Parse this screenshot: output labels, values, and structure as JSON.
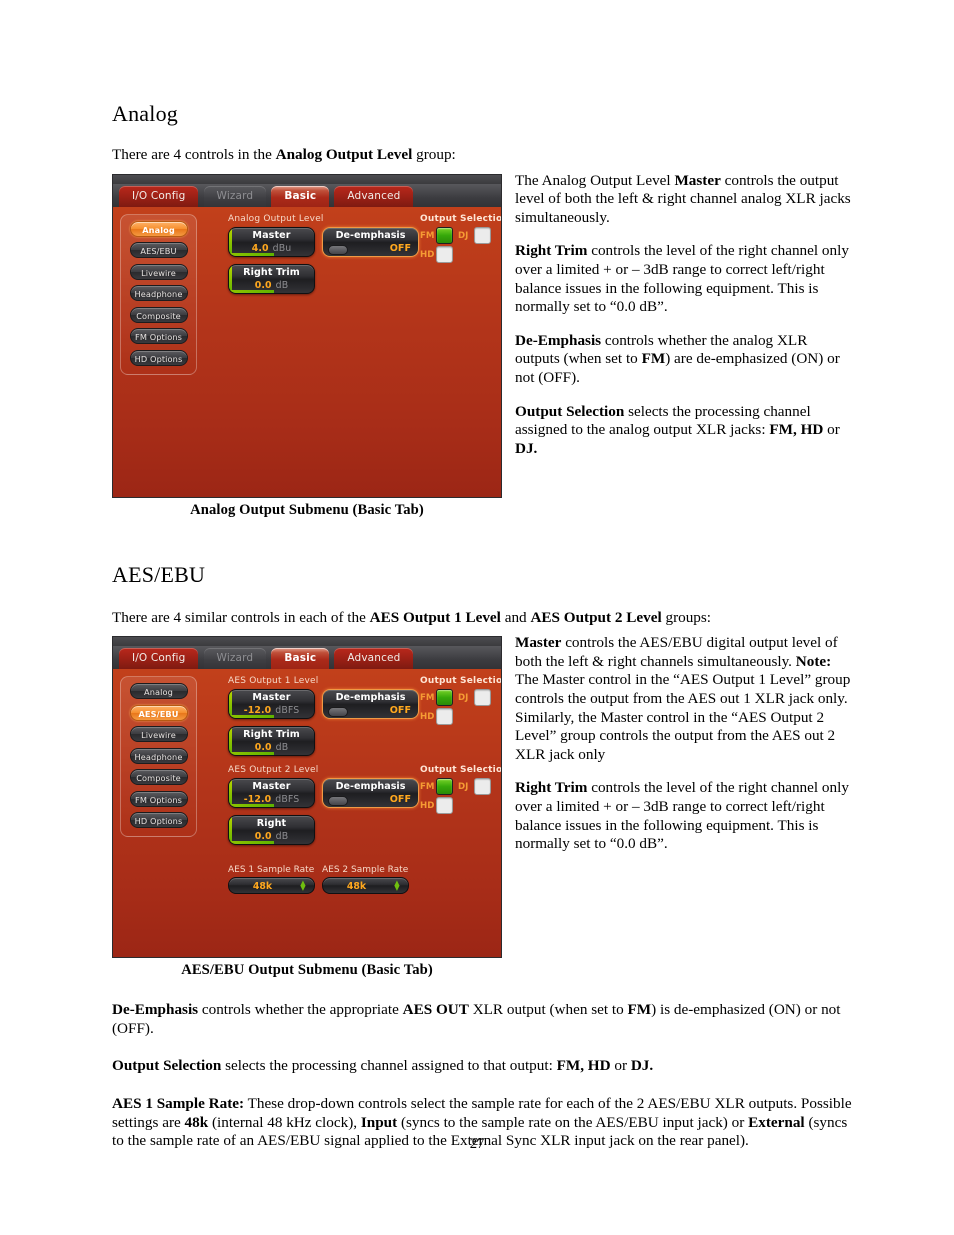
{
  "page": {
    "number": "27"
  },
  "section1": {
    "heading": "Analog",
    "intro_a": "There are 4 controls in the ",
    "intro_b": "Analog Output Level",
    "intro_c": " group:",
    "caption": "Analog Output Submenu (Basic Tab)",
    "para1": {
      "t1": "The Analog Output Level ",
      "b1": "Master",
      "t2": " controls the output level of both the left & right channel analog XLR jacks simultaneously."
    },
    "para2": {
      "b1": "Right Trim",
      "t1": " controls the level of the right channel only over a limited + or – 3dB range to correct left/right balance issues in the following equipment. This is normally set to “0.0 dB”."
    },
    "para3": {
      "b1": "De-Emphasis",
      "t1": " controls whether the analog XLR outputs (when set to ",
      "b2": "FM",
      "t2": ") are de-emphasized (ON) or not (OFF)."
    },
    "para4": {
      "b1": "Output Selection",
      "t1": " selects the processing channel assigned to the analog output XLR jacks: ",
      "b2": "FM, HD",
      "t2": " or ",
      "b3": "DJ."
    }
  },
  "section2": {
    "heading": "AES/EBU",
    "intro_a": "There are 4 similar controls in each of the ",
    "intro_b": "AES Output 1 Level",
    "intro_c": " and ",
    "intro_d": "AES Output 2 Level",
    "intro_e": " groups:",
    "caption": "AES/EBU Output Submenu (Basic Tab)",
    "para1": {
      "b1": "Master",
      "t1": " controls the AES/EBU digital output level of both the left & right channels simultaneously. ",
      "b2": "Note:",
      "t2": " The Master control in the “AES Output 1 Level” group controls the output from the AES out 1 XLR jack only. Similarly, the Master control in the “AES Output 2 Level” group controls the output from the AES out 2 XLR jack only"
    },
    "para2": {
      "b1": "Right Trim",
      "t1": " controls the level of the right channel only over a limited + or – 3dB range to correct left/right balance issues in the following equipment. This is normally set to “0.0 dB”."
    },
    "para3": {
      "b1": "De-Emphasis",
      "t1": " controls whether the appropriate ",
      "b2": "AES OUT",
      "t2": " XLR output (when set to ",
      "b3": "FM",
      "t3": ") is de-emphasized (ON) or not (OFF)."
    },
    "para4": {
      "b1": "Output Selection",
      "t1": " selects the processing channel assigned to that output: ",
      "b2": "FM, HD",
      "t2": " or ",
      "b3": "DJ."
    },
    "para5": {
      "b1": "AES 1 Sample Rate:",
      "t1": " These drop-down controls select the sample rate for each of the 2 AES/EBU XLR outputs. Possible settings are ",
      "b2": "48k",
      "t2": " (internal 48 kHz clock), ",
      "b3": "Input",
      "t3": " (syncs to the sample rate on the AES/EBU input jack) or ",
      "b4": "External",
      "t4": " (syncs to the sample rate of an AES/EBU signal applied to the External Sync XLR input jack on the rear panel)."
    }
  },
  "ui": {
    "tabs": [
      {
        "label": "I/O Config",
        "state": "red"
      },
      {
        "label": "Wizard",
        "state": "dark"
      },
      {
        "label": "Basic",
        "state": "active"
      },
      {
        "label": "Advanced",
        "state": "red"
      }
    ],
    "nav": [
      {
        "label": "Analog"
      },
      {
        "label": "AES/EBU"
      },
      {
        "label": "Livewire"
      },
      {
        "label": "Headphone"
      },
      {
        "label": "Composite"
      },
      {
        "label": "FM Options"
      },
      {
        "label": "HD Options"
      }
    ],
    "colors": {
      "panel_orange": "#b5361a",
      "accent_orange": "#ffa81e",
      "led_green": "#36a80a",
      "tab_red": "#9a2015"
    },
    "analog_panel": {
      "selected_nav": "Analog",
      "group_label": "Analog Output Level",
      "master": {
        "name": "Master",
        "value": "4.0",
        "unit": "dBu"
      },
      "right_trim": {
        "name": "Right Trim",
        "value": "0.0",
        "unit": "dB"
      },
      "deemphasis": {
        "name": "De-emphasis",
        "value": "OFF"
      },
      "output_selection": {
        "title": "Output Selection",
        "fm_label": "FM",
        "fm_on": true,
        "dj_label": "DJ",
        "dj_on": false,
        "hd_label": "HD",
        "hd_on": false
      }
    },
    "aes_panel": {
      "selected_nav": "AES/EBU",
      "group1_label": "AES Output 1 Level",
      "group2_label": "AES Output 2 Level",
      "g1_master": {
        "name": "Master",
        "value": "-12.0",
        "unit": "dBFS"
      },
      "g1_right": {
        "name": "Right Trim",
        "value": "0.0",
        "unit": "dB"
      },
      "g1_deemphasis": {
        "name": "De-emphasis",
        "value": "OFF"
      },
      "g2_master": {
        "name": "Master",
        "value": "-12.0",
        "unit": "dBFS"
      },
      "g2_right": {
        "name": "Right",
        "value": "0.0",
        "unit": "dB"
      },
      "g2_deemphasis": {
        "name": "De-emphasis",
        "value": "OFF"
      },
      "output_selection_1": {
        "title": "Output Selection",
        "fm_label": "FM",
        "fm_on": true,
        "dj_label": "DJ",
        "dj_on": false,
        "hd_label": "HD",
        "hd_on": false
      },
      "output_selection_2": {
        "title": "Output Selection",
        "fm_label": "FM",
        "fm_on": true,
        "dj_label": "DJ",
        "dj_on": false,
        "hd_label": "HD",
        "hd_on": false
      },
      "sr1": {
        "label": "AES 1 Sample Rate",
        "value": "48k"
      },
      "sr2": {
        "label": "AES 2 Sample Rate",
        "value": "48k"
      }
    }
  }
}
